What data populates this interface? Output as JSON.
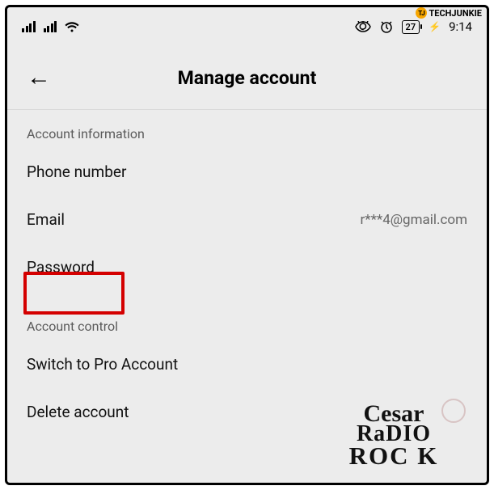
{
  "status": {
    "battery": "27",
    "time": "9:14"
  },
  "header": {
    "title": "Manage account"
  },
  "sections": {
    "info_head": "Account information",
    "control_head": "Account control"
  },
  "rows": {
    "phone_label": "Phone number",
    "email_label": "Email",
    "email_value": "r***4@gmail.com",
    "password_label": "Password",
    "switch_pro_label": "Switch to Pro Account",
    "delete_label": "Delete account"
  },
  "watermarks": {
    "techjunkie": "TECHJUNKIE",
    "rock_l1": "Cesar",
    "rock_l2": "RaDIO",
    "rock_l3": "ROC K"
  }
}
